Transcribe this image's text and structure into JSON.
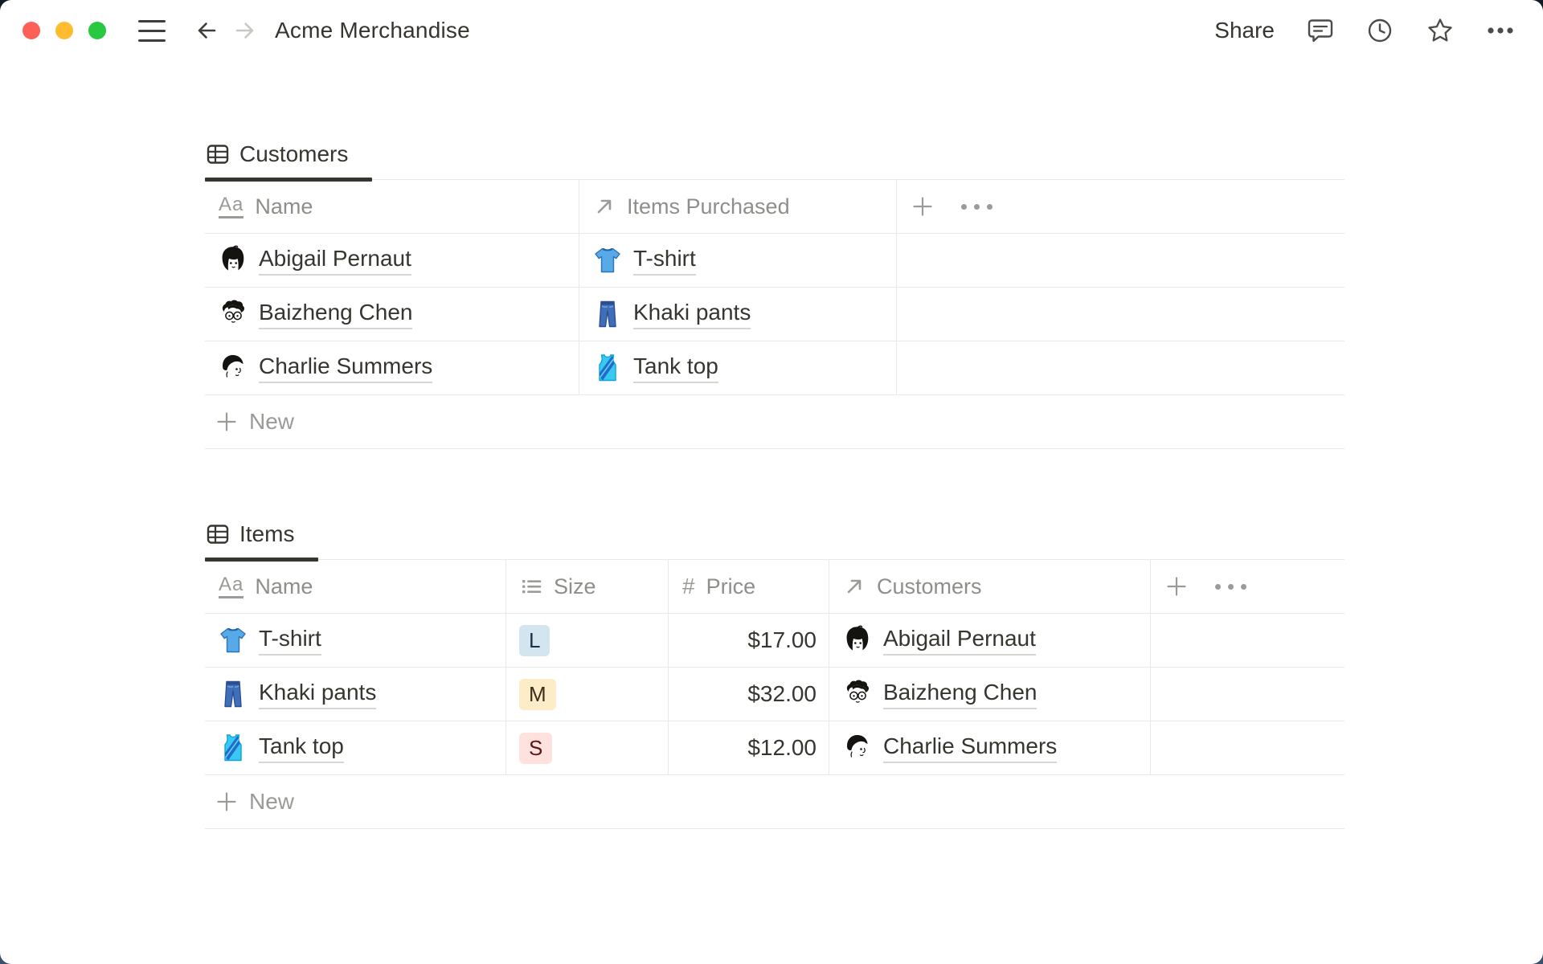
{
  "window": {
    "title": "Acme Merchandise",
    "topbar": {
      "share_label": "Share",
      "icons": [
        "hamburger-menu",
        "back-arrow",
        "forward-arrow",
        "comment-icon",
        "clock-icon",
        "star-icon",
        "more-dots"
      ]
    },
    "traffic_lights": {
      "close": "#fe5f57",
      "minimize": "#febc2e",
      "zoom": "#28c840"
    }
  },
  "customers_table": {
    "tab_label": "Customers",
    "columns": [
      {
        "label": "Name",
        "type": "text",
        "icon": "Aa"
      },
      {
        "label": "Items Purchased",
        "type": "relation",
        "icon": "arrow-up-right"
      }
    ],
    "header_actions": {
      "add": "+",
      "more": "•••"
    },
    "rows": [
      {
        "name": "Abigail Pernaut",
        "avatar": "abigail-avatar",
        "item": "T-shirt",
        "item_icon": "tshirt"
      },
      {
        "name": "Baizheng Chen",
        "avatar": "baizheng-avatar",
        "item": "Khaki pants",
        "item_icon": "jeans"
      },
      {
        "name": "Charlie Summers",
        "avatar": "charlie-avatar",
        "item": "Tank top",
        "item_icon": "tanktop"
      }
    ],
    "new_label": "New"
  },
  "items_table": {
    "tab_label": "Items",
    "columns": [
      {
        "label": "Name",
        "type": "text",
        "icon": "Aa"
      },
      {
        "label": "Size",
        "type": "select",
        "icon": "list"
      },
      {
        "label": "Price",
        "type": "number",
        "icon": "#"
      },
      {
        "label": "Customers",
        "type": "relation",
        "icon": "arrow-up-right"
      }
    ],
    "header_actions": {
      "add": "+",
      "more": "•••"
    },
    "rows": [
      {
        "name": "T-shirt",
        "icon": "tshirt",
        "size": "L",
        "size_color": "blue",
        "price": "$17.00",
        "customer": "Abigail Pernaut",
        "customer_avatar": "abigail-avatar"
      },
      {
        "name": "Khaki pants",
        "icon": "jeans",
        "size": "M",
        "size_color": "yellow",
        "price": "$32.00",
        "customer": "Baizheng Chen",
        "customer_avatar": "baizheng-avatar"
      },
      {
        "name": "Tank top",
        "icon": "tanktop",
        "size": "S",
        "size_color": "red",
        "price": "$12.00",
        "customer": "Charlie Summers",
        "customer_avatar": "charlie-avatar"
      }
    ],
    "new_label": "New"
  },
  "colors": {
    "tag_blue_bg": "#d3e5ef",
    "tag_yellow_bg": "#fdecc8",
    "tag_red_bg": "#ffe2dd",
    "border": "#e9e9e7",
    "text_dark": "#37352f",
    "text_gray": "#8f8e8a",
    "tab_underline": "#37352f"
  }
}
